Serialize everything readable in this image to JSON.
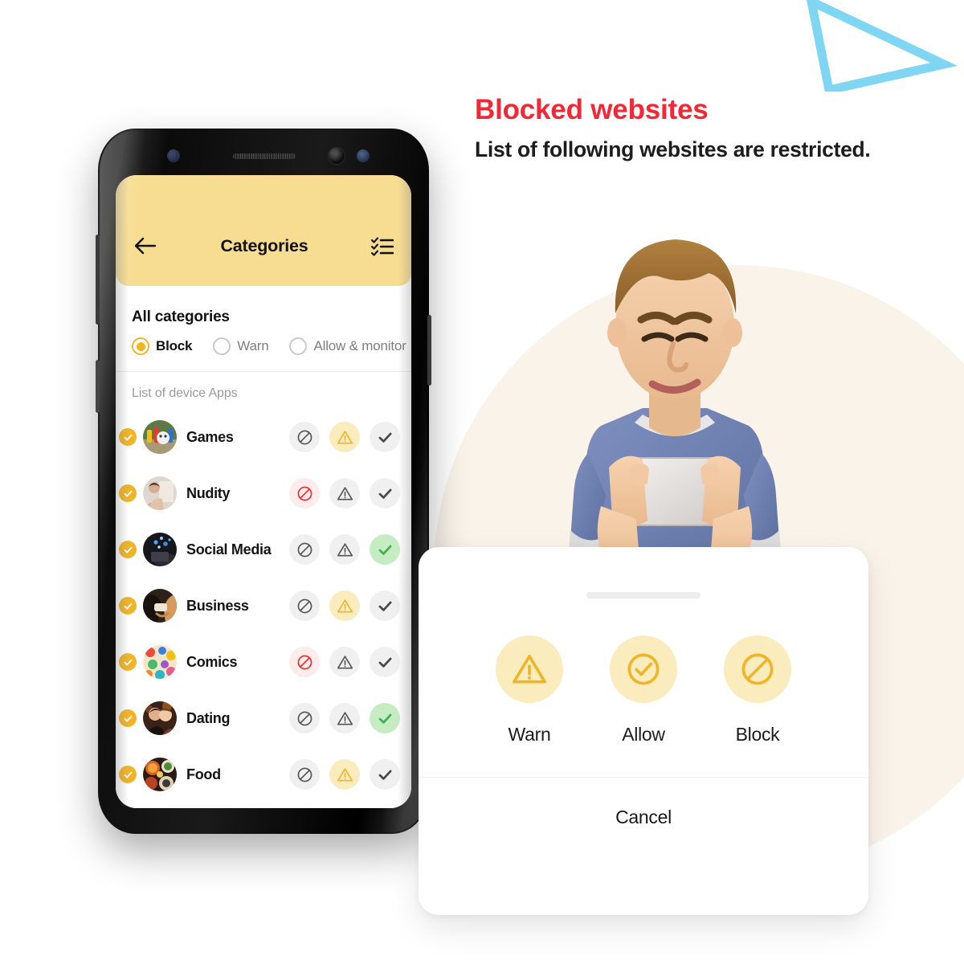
{
  "headline": {
    "title": "Blocked websites",
    "subtitle": "List of following websites are restricted.",
    "title_color": "#f32735",
    "subtitle_color": "#1d1d1f"
  },
  "decor": {
    "triangle_color": "#7ed6f2",
    "circle_color": "#f9f3ea"
  },
  "phone": {
    "appbar": {
      "back_icon": "arrow-left-icon",
      "title": "Categories",
      "menu_icon": "checklist-icon",
      "background_color": "#f7dd92"
    },
    "section_title": "All categories",
    "modes": [
      {
        "label": "Block",
        "selected": true
      },
      {
        "label": "Warn",
        "selected": false
      },
      {
        "label": "Allow & monitor",
        "selected": false
      }
    ],
    "list_header": "List of device Apps",
    "rows": [
      {
        "name": "Games",
        "avatar": "games-thumb",
        "state": "warn",
        "badge": "check-badge"
      },
      {
        "name": "Nudity",
        "avatar": "nudity-thumb",
        "state": "block",
        "badge": "check-badge"
      },
      {
        "name": "Social Media",
        "avatar": "social-media-thumb",
        "state": "allow",
        "badge": "check-badge"
      },
      {
        "name": "Business",
        "avatar": "business-thumb",
        "state": "warn",
        "badge": "check-badge"
      },
      {
        "name": "Comics",
        "avatar": "comics-thumb",
        "state": "block",
        "badge": "check-badge"
      },
      {
        "name": "Dating",
        "avatar": "dating-thumb",
        "state": "allow",
        "badge": "check-badge"
      },
      {
        "name": "Food",
        "avatar": "food-thumb",
        "state": "warn",
        "badge": "check-badge"
      }
    ],
    "action_icons": [
      "block-icon",
      "warn-icon",
      "allow-icon"
    ]
  },
  "sheet": {
    "options": [
      {
        "label": "Warn",
        "icon": "warn-icon"
      },
      {
        "label": "Allow",
        "icon": "allow-icon"
      },
      {
        "label": "Block",
        "icon": "block-icon"
      }
    ],
    "cancel_label": "Cancel"
  },
  "colors": {
    "accent_yellow": "#f0b429",
    "soft_yellow": "#fbecbe",
    "allow_green": "#3fb24a",
    "allow_green_bg": "#c6ecc3",
    "block_red": "#e8302a",
    "block_red_bg": "#fdeceb",
    "neutral_grey": "#f0f0f0",
    "icon_grey": "#555555"
  }
}
